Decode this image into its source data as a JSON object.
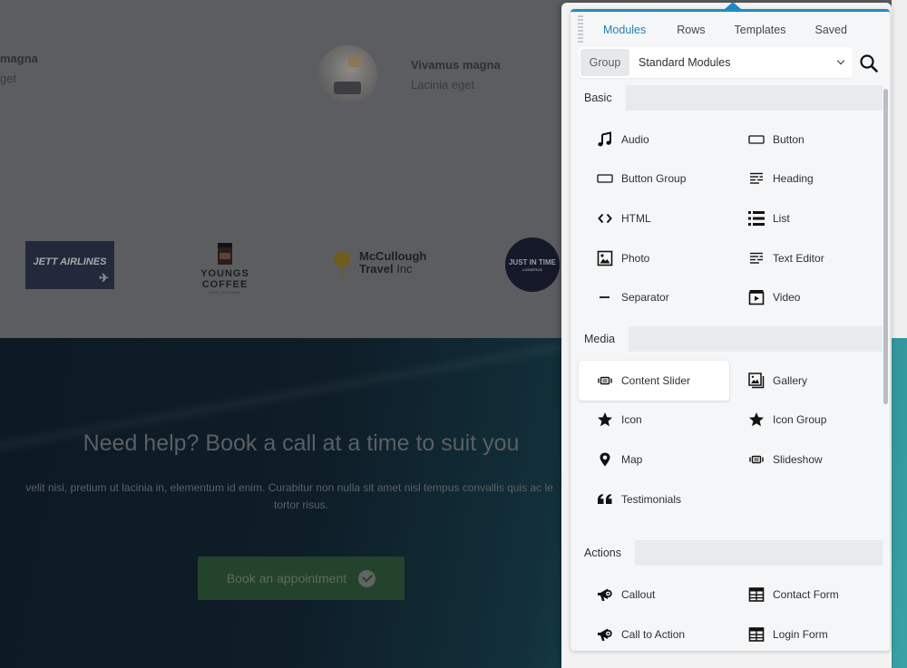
{
  "background_page": {
    "testimonials": [
      {
        "name": "magna",
        "subtitle": "get"
      },
      {
        "name": "Vivamus magna",
        "subtitle": "Lacinia eget"
      }
    ],
    "logos": {
      "jett": "JETT AIRLINES",
      "youngs_title": "YOUNGS COFFEE",
      "youngs_sub": "100% ORGANIC",
      "mcc_line1": "McCullough",
      "mcc_line2a": "Travel",
      "mcc_line2b": " Inc",
      "jit_line1": "JUST IN TIME",
      "jit_line2": "LOGISTICS"
    },
    "cta": {
      "title": "Need help? Book a call at a time to suit you",
      "body_line1": "velit nisi, pretium ut lacinia in, elementum id enim. Curabitur non nulla sit amet nisl tempus convallis quis ac le",
      "body_line2": "tortor risus.",
      "button_label": "Book an appointment"
    }
  },
  "panel": {
    "accent_color": "#1f8dc4",
    "tabs": [
      {
        "label": "Modules",
        "active": true
      },
      {
        "label": "Rows",
        "active": false
      },
      {
        "label": "Templates",
        "active": false
      },
      {
        "label": "Saved",
        "active": false
      }
    ],
    "group_label": "Group",
    "group_selected": "Standard Modules",
    "sections": [
      {
        "title": "Basic",
        "items": [
          {
            "label": "Audio",
            "icon": "music-note-icon"
          },
          {
            "label": "Button",
            "icon": "button-icon"
          },
          {
            "label": "Button Group",
            "icon": "button-group-icon"
          },
          {
            "label": "Heading",
            "icon": "heading-icon"
          },
          {
            "label": "HTML",
            "icon": "code-icon"
          },
          {
            "label": "List",
            "icon": "list-icon"
          },
          {
            "label": "Photo",
            "icon": "photo-icon"
          },
          {
            "label": "Text Editor",
            "icon": "text-editor-icon"
          },
          {
            "label": "Separator",
            "icon": "separator-icon"
          },
          {
            "label": "Video",
            "icon": "video-icon"
          }
        ]
      },
      {
        "title": "Media",
        "items": [
          {
            "label": "Content Slider",
            "icon": "slider-icon",
            "hover": true
          },
          {
            "label": "Gallery",
            "icon": "gallery-icon"
          },
          {
            "label": "Icon",
            "icon": "star-icon"
          },
          {
            "label": "Icon Group",
            "icon": "star-icon"
          },
          {
            "label": "Map",
            "icon": "map-pin-icon"
          },
          {
            "label": "Slideshow",
            "icon": "slider-icon"
          },
          {
            "label": "Testimonials",
            "icon": "quote-icon"
          }
        ]
      },
      {
        "title": "Actions",
        "items": [
          {
            "label": "Callout",
            "icon": "megaphone-icon"
          },
          {
            "label": "Contact Form",
            "icon": "form-table-icon"
          },
          {
            "label": "Call to Action",
            "icon": "megaphone-icon"
          },
          {
            "label": "Login Form",
            "icon": "form-table-icon"
          }
        ]
      }
    ]
  }
}
